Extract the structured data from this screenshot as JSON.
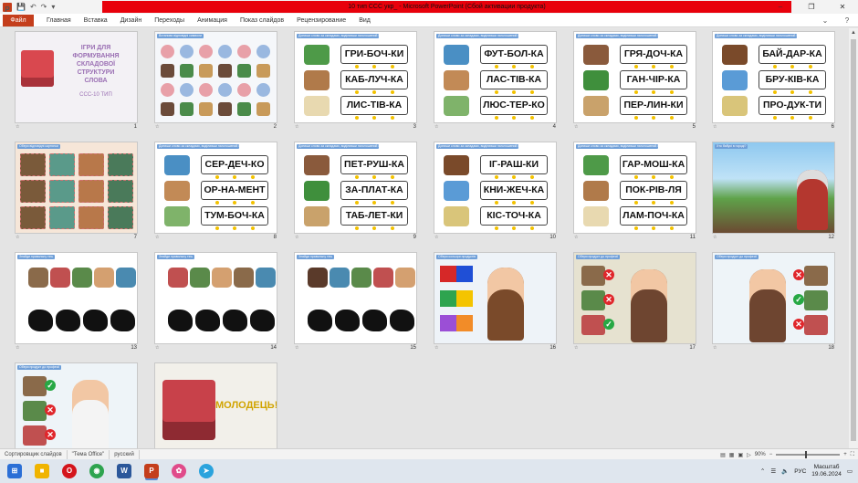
{
  "window": {
    "title": "10 тип ССС укр_ - Microsoft PowerPoint (Сбой активации продукта)"
  },
  "ribbon": {
    "file": "Файл",
    "tabs": [
      "Главная",
      "Вставка",
      "Дизайн",
      "Переходы",
      "Анимация",
      "Показ слайдов",
      "Рецензирование",
      "Вид"
    ]
  },
  "slides": [
    {
      "num": "1",
      "title_lines": [
        "ІГРИ ДЛЯ",
        "ФОРМУВАННЯ",
        "СКЛАДОВОЇ",
        "СТРУКТУРИ",
        "СЛОВА"
      ],
      "subtitle": "ССС-10 ТИП"
    },
    {
      "num": "2",
      "tag": "Встанови відповідні символи"
    },
    {
      "num": "3",
      "tag": "Допиши слово за складами, виділивши наголошений склад",
      "words": [
        "ГРИ-БОЧ-КИ",
        "КАБ-ЛУЧ-КА",
        "ЛИС-ТІВ-КА"
      ]
    },
    {
      "num": "4",
      "tag": "Допиши слово за складами, виділивши наголошений склад",
      "words": [
        "ФУТ-БОЛ-КА",
        "ЛАС-ТІВ-КА",
        "ЛЮС-ТЕР-КО"
      ]
    },
    {
      "num": "5",
      "tag": "Допиши слово за складами, виділивши наголошений склад",
      "words": [
        "ГРЯ-ДОЧ-КА",
        "ГАН-ЧІР-КА",
        "ПЕР-ЛИН-КИ"
      ]
    },
    {
      "num": "6",
      "tag": "Допиши слово за складами, виділивши наголошений склад",
      "words": [
        "БАЙ-ДАР-КА",
        "БРУ-КІВ-КА",
        "ПРО-ДУК-ТИ"
      ]
    },
    {
      "num": "7",
      "tag": "Обери відповідні картинки"
    },
    {
      "num": "8",
      "tag": "Допиши слово за складами, виділивши наголошений склад",
      "words": [
        "СЕР-ДЕЧ-КО",
        "ОР-НА-МЕНТ",
        "ТУМ-БОЧ-КА"
      ]
    },
    {
      "num": "9",
      "tag": "Допиши слово за складами, виділивши наголошений склад",
      "words": [
        "ПЕТ-РУШ-КА",
        "ЗА-ПЛАТ-КА",
        "ТАБ-ЛЕТ-КИ"
      ]
    },
    {
      "num": "10",
      "tag": "Допиши слово за складами, виділивши наголошений склад",
      "words": [
        "ІГ-РАШ-КИ",
        "КНИ-ЖЕЧ-КА",
        "КІС-ТОЧ-КА"
      ]
    },
    {
      "num": "11",
      "tag": "Допиши слово за складами, виділивши наголошений склад",
      "words": [
        "ГАР-МОШ-КА",
        "ПОК-РІВ-ЛЯ",
        "ЛАМ-ПОЧ-КА"
      ]
    },
    {
      "num": "12",
      "tag": "Хто бабусі в городі?"
    },
    {
      "num": "13",
      "tag": "Знайди правильну тінь"
    },
    {
      "num": "14",
      "tag": "Знайди правильну тінь"
    },
    {
      "num": "15",
      "tag": "Знайди правильну тінь"
    },
    {
      "num": "16",
      "tag": "Обери кольори продуктів"
    },
    {
      "num": "17",
      "tag": "Обери продукт до професії"
    },
    {
      "num": "18",
      "tag": "Обери продукт до професії"
    },
    {
      "num": "19",
      "tag": "Обери продукт до професії"
    },
    {
      "num": "20",
      "final_text": "МОЛОДЕЦЬ!"
    }
  ],
  "statusbar": {
    "view": "Сортировщик слайдов",
    "theme": "\"Тема Office\"",
    "lang": "русский",
    "zoom": "90%"
  },
  "taskbar": {
    "lang": "РУС",
    "time": "Масштаб",
    "date": "19.06.2024"
  },
  "colors": {
    "accent": "#c43e1c",
    "title_red": "#e8000b",
    "tag": "#6f9fd8"
  }
}
